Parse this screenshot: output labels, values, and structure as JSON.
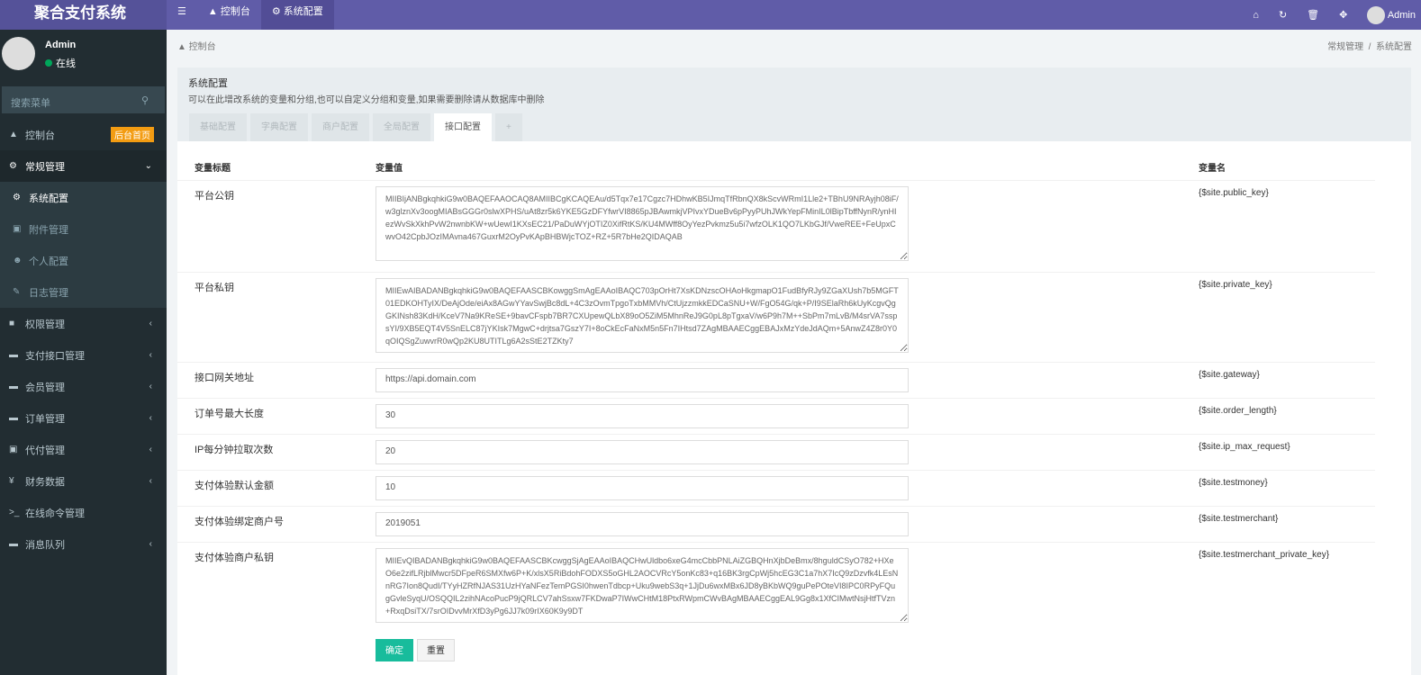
{
  "app": {
    "title": "聚合支付系统"
  },
  "topnav": {
    "menu_icon": "bars-icon",
    "items": [
      {
        "icon": "dashboard-icon",
        "label": "控制台"
      },
      {
        "icon": "gear-icon",
        "label": "系统配置"
      }
    ],
    "user": "Admin"
  },
  "sidebar": {
    "user": {
      "name": "Admin",
      "status": "在线"
    },
    "search_placeholder": "搜索菜单",
    "items": [
      {
        "label": "控制台",
        "badge": "后台首页"
      },
      {
        "label": "常规管理"
      },
      {
        "label": "系统配置"
      },
      {
        "label": "附件管理"
      },
      {
        "label": "个人配置"
      },
      {
        "label": "日志管理"
      },
      {
        "label": "权限管理"
      },
      {
        "label": "支付接口管理"
      },
      {
        "label": "会员管理"
      },
      {
        "label": "订单管理"
      },
      {
        "label": "代付管理"
      },
      {
        "label": "财务数据"
      },
      {
        "label": "在线命令管理"
      },
      {
        "label": "消息队列"
      }
    ]
  },
  "breadcrumb": {
    "home": "控制台",
    "path": [
      "常规管理",
      "系统配置"
    ]
  },
  "panel": {
    "title": "系统配置",
    "desc": "可以在此增改系统的变量和分组,也可以自定义分组和变量,如果需要删除请从数据库中删除",
    "tabs": [
      "基础配置",
      "字典配置",
      "商户配置",
      "全局配置",
      "接口配置",
      "+"
    ],
    "headers": [
      "变量标题",
      "变量值",
      "变量名"
    ],
    "rows": [
      {
        "label": "平台公钥",
        "value": "MIIBIjANBgkqhkiG9w0BAQEFAAOCAQ8AMIIBCgKCAQEAu/d5Tqx7e17Cgzc7HDhwKB5IJmqTfRbnQX8kScvWRmI1Lle2+TBhU9NRAyjh08iF/w3glznXv3oogMIABsGGGr0slwXPHS/uAt8zr5k6YKE5GzDFYfwrVI8865pJBAwmkjVPIvxYDueBv6pPyyPUhJWkYepFMinIL0lBipTbffNynR/ynHIezWvSkXkhPvW2nwnbKW+wUewI1KXsEC21/PaDuWYjOTIZ0XifRtKS/KU4MWff8OyYezPvkmz5u5i7wfzOLK1QO7LKbGJf/VweREE+FeUpxCwvO42CpbJOzIMAvna467GuxrM2OyPvKApBHBWjcTOZ+RZ+5R7bHe2QIDAQAB",
        "name": "{$site.public_key}",
        "type": "textarea"
      },
      {
        "label": "平台私钥",
        "value": "MIIEwAIBADANBgkqhkiG9w0BAQEFAASCBKowggSmAgEAAoIBAQC703pOrHt7XsKDNzscOHAoHkgmapO1FudBfyRJy9ZGaXUsh7b5MGFT01EDKOHTyIX/DeAjOde/eiAx8AGwYYavSwjBc8dL+4C3zOvmTpgoTxbMMVh/CtUjzzmkkEDCaSNU+W/FgO54G/qk+P/I9SElaRh6kUyKcgvQgGKINsh83KdH/KceV7Na9KReSE+9bavCFspb7BR7CXUpewQLbX89oO5ZiM5MhnReJ9G0pL8pTgxaV/w6P9h7M++SbPm7mLvB/M4srVA7sspsYI/9XB5EQT4V5SnELC87jYKIsk7MgwC+drjtsa7GszY7I+8oCkEcFaNxM5n5Fn7IHtsd7ZAgMBAAECggEBAJxMzYdeJdAQm+5AnwZ4Z8r0Y0qOIQSgZuwvrR0wQp2KU8UTITLg6A2sStE2TZKty7",
        "name": "{$site.private_key}",
        "type": "textarea"
      },
      {
        "label": "接口网关地址",
        "value": "https://api.domain.com",
        "name": "{$site.gateway}",
        "type": "input"
      },
      {
        "label": "订单号最大长度",
        "value": "30",
        "name": "{$site.order_length}",
        "type": "input"
      },
      {
        "label": "IP每分钟拉取次数",
        "value": "20",
        "name": "{$site.ip_max_request}",
        "type": "input"
      },
      {
        "label": "支付体验默认金额",
        "value": "10",
        "name": "{$site.testmoney}",
        "type": "input"
      },
      {
        "label": "支付体验绑定商户号",
        "value": "2019051",
        "name": "{$site.testmerchant}",
        "type": "input"
      },
      {
        "label": "支付体验商户私钥",
        "value": "MIIEvQIBADANBgkqhkiG9w0BAQEFAASCBKcwggSjAgEAAoIBAQCHwUldbo6xeG4mcCbbPNLAiZGBQHnXjbDeBmx/8hguldCSyO782+HXeO6e2zifLRjblMwcr5DFpeR6SMXfw6P+K/xlsX5RiBdohFODXS5oGHL2AOCVRcY5onKc83+q16BK3rgCpWj5hcEG3C1a7hX7IcQ9zDzvfk4LEsNnRG7Ion8QudI/TYyHZRfNJAS31UzHYaNFezTemPGSI0hwenTdbcp+Uku9webS3q+1JjDu6wxMBx6JD8yBKbWQ9guPePOteVI8IPC0RPyFQugGvleSyqU/OSQQIL2zihNAcoPucP9jQRLCV7ahSsxw7FKDwaP7IWwCHtM18PtxRWpmCWvBAgMBAAECggEAL9Gg8x1XfCIMwtNsjHtfTVzn+RxqDsiTX/7srOIDvvMrXfD3yPg6JJ7k09rIX60K9y9DT",
        "name": "{$site.testmerchant_private_key}",
        "type": "textarea"
      }
    ],
    "buttons": {
      "submit": "确定",
      "reset": "重置"
    }
  },
  "colors": {
    "topbar": "#605ca8",
    "sidebar": "#222d32",
    "badge": "#f39c12",
    "submit": "#18bc9c"
  }
}
